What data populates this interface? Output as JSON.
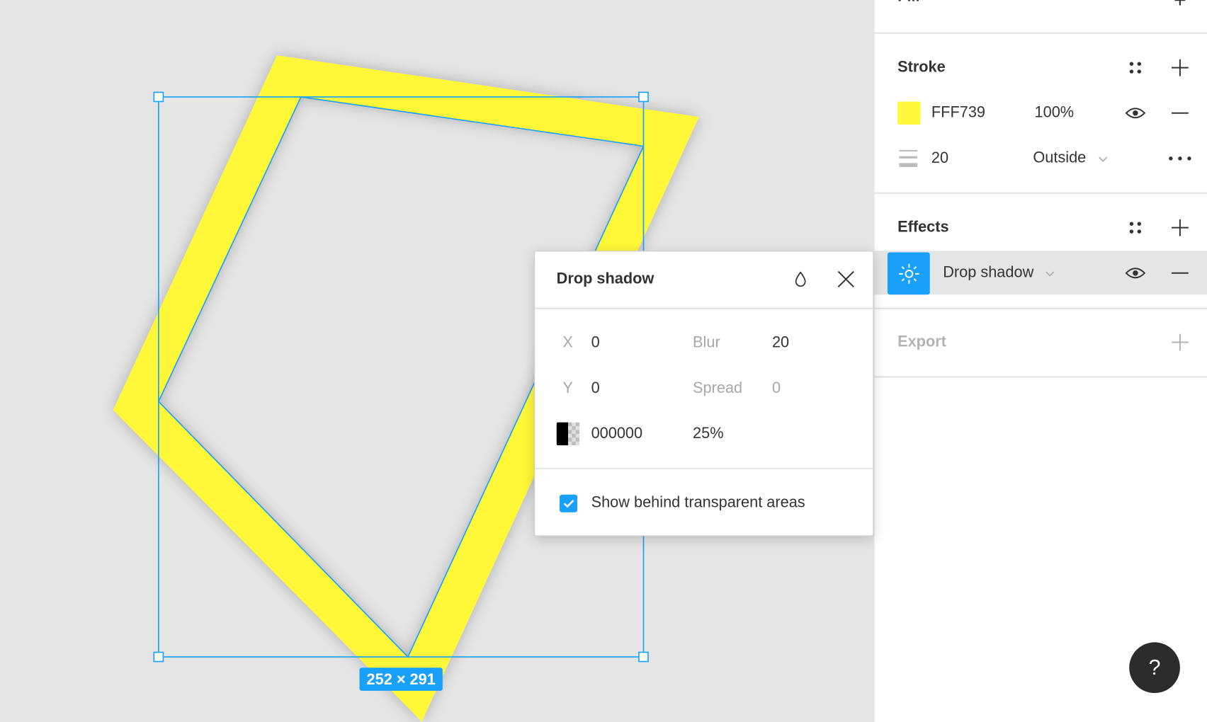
{
  "canvas": {
    "dimension_label": "252 × 291",
    "shape_fill": "#FFF739",
    "selection_color": "#18A0FB"
  },
  "panel": {
    "fill": {
      "heading": "Fill"
    },
    "stroke": {
      "heading": "Stroke",
      "color_hex": "FFF739",
      "color": "#FFF739",
      "opacity": "100%",
      "weight": "20",
      "position": "Outside"
    },
    "effects": {
      "heading": "Effects",
      "effect_name": "Drop shadow"
    },
    "export": {
      "heading": "Export"
    }
  },
  "popup": {
    "title": "Drop shadow",
    "x_label": "X",
    "x_value": "0",
    "y_label": "Y",
    "y_value": "0",
    "blur_label": "Blur",
    "blur_value": "20",
    "spread_label": "Spread",
    "spread_value": "0",
    "color_hex": "000000",
    "opacity": "25%",
    "checkbox_label": "Show behind transparent areas",
    "checkbox_checked": true
  },
  "help": {
    "label": "?"
  }
}
